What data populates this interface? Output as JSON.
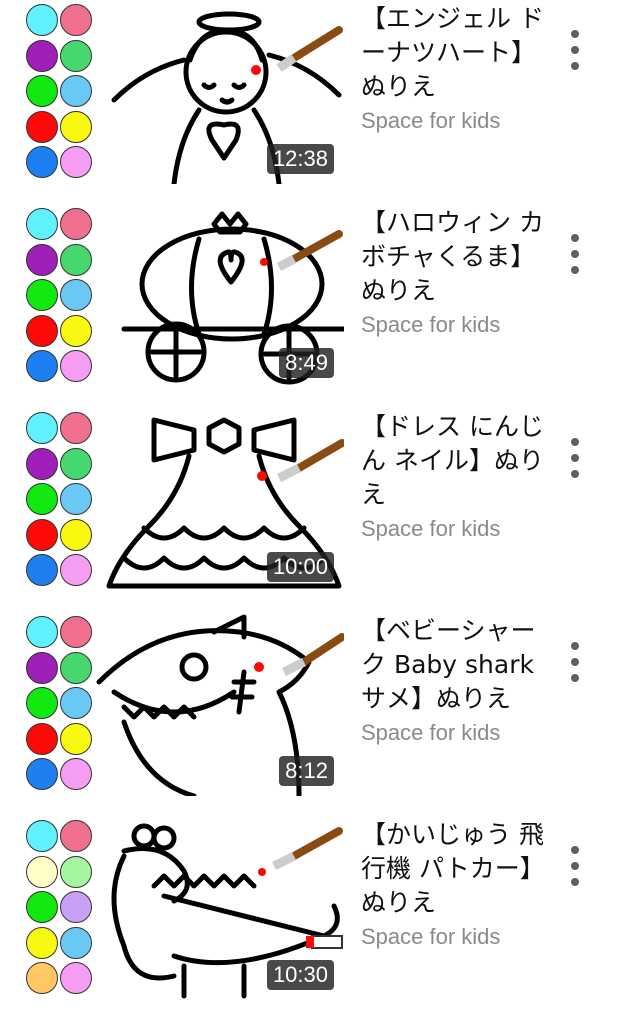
{
  "videos": [
    {
      "title": "【エンジェル ドーナツハート】ぬりえ",
      "channel": "Space for kids",
      "duration": "12:38",
      "drawing": "angel",
      "palette": [
        "#5ff2ff",
        "#f2708f",
        "#a01fb8",
        "#46d86e",
        "#10e810",
        "#6ac8f5",
        "#ff0808",
        "#f8f810",
        "#1e80f0",
        "#f59df2"
      ]
    },
    {
      "title": "【ハロウィン カボチャくるま】ぬりえ",
      "channel": "Space for kids",
      "duration": "8:49",
      "drawing": "pumpkin-carriage",
      "palette": [
        "#5ff2ff",
        "#f2708f",
        "#a01fb8",
        "#46d86e",
        "#10e810",
        "#6ac8f5",
        "#ff0808",
        "#f8f810",
        "#1e80f0",
        "#f59df2"
      ]
    },
    {
      "title": "【ドレス にんじん ネイル】ぬりえ",
      "channel": "Space for kids",
      "duration": "10:00",
      "drawing": "dress",
      "palette": [
        "#5ff2ff",
        "#f2708f",
        "#a01fb8",
        "#46d86e",
        "#10e810",
        "#6ac8f5",
        "#ff0808",
        "#f8f810",
        "#1e80f0",
        "#f59df2"
      ]
    },
    {
      "title": "【ベビーシャーク Baby shark サメ】ぬりえ",
      "channel": "Space for kids",
      "duration": "8:12",
      "drawing": "shark",
      "palette": [
        "#5ff2ff",
        "#f2708f",
        "#a01fb8",
        "#46d86e",
        "#10e810",
        "#6ac8f5",
        "#ff0808",
        "#f8f810",
        "#1e80f0",
        "#f59df2"
      ]
    },
    {
      "title": "【かいじゅう 飛行機 パトカー】ぬりえ",
      "channel": "Space for kids",
      "duration": "10:30",
      "drawing": "dinosaur",
      "palette": [
        "#5ff2ff",
        "#f2708f",
        "#ffffc8",
        "#a6f5a0",
        "#10e810",
        "#c8a0f5",
        "#f8f810",
        "#6ac8f5",
        "#ffc864",
        "#f59df2"
      ]
    }
  ]
}
